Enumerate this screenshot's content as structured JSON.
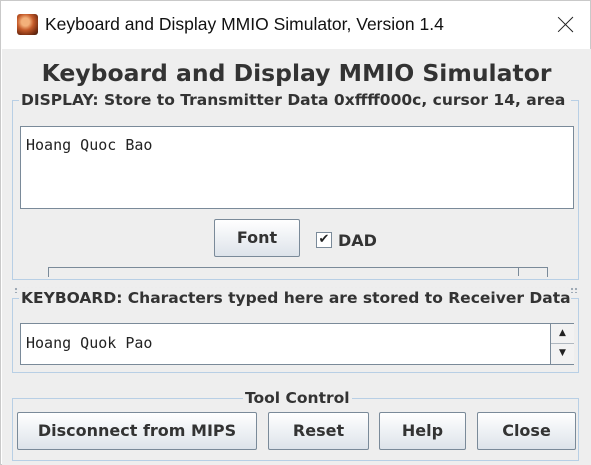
{
  "window": {
    "title": "Keyboard and Display MMIO Simulator, Version 1.4",
    "app_icon": "mars-planet-icon",
    "close_icon": "close-icon"
  },
  "heading": "Keyboard and Display MMIO Simulator",
  "display": {
    "title": "DISPLAY: Store to Transmitter Data 0xffff000c, cursor 14, area ...",
    "text": "Hoang Quoc Bao",
    "font_button": "Font",
    "dad_checkbox": {
      "label": "DAD",
      "checked": true
    }
  },
  "keyboard": {
    "title": "KEYBOARD: Characters typed here are stored to Receiver Data ...",
    "text": "Hoang Quok Pao"
  },
  "tool_control": {
    "title": "Tool Control",
    "buttons": {
      "disconnect": "Disconnect from MIPS",
      "reset": "Reset",
      "help": "Help",
      "close": "Close"
    }
  }
}
